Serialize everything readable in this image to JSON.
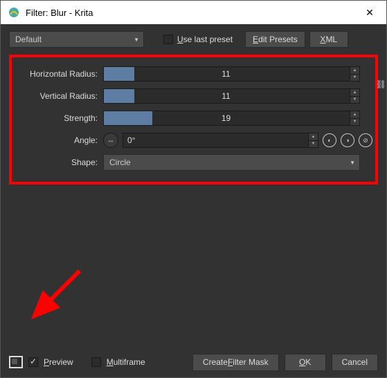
{
  "window": {
    "title": "Filter: Blur - Krita"
  },
  "top": {
    "preset": "Default",
    "use_last_preset": "Use last preset",
    "edit_presets": "Edit Presets",
    "xml": "XML"
  },
  "params": {
    "hradius_label": "Horizontal Radius:",
    "hradius_value": "11",
    "vradius_label": "Vertical Radius:",
    "vradius_value": "11",
    "strength_label": "Strength:",
    "strength_value": "19",
    "angle_label": "Angle:",
    "angle_value": "0°",
    "shape_label": "Shape:",
    "shape_value": "Circle"
  },
  "bottom": {
    "preview": "Preview",
    "multiframe": "Multiframe",
    "create_mask": "Create Filter Mask",
    "ok": "OK",
    "cancel": "Cancel"
  }
}
